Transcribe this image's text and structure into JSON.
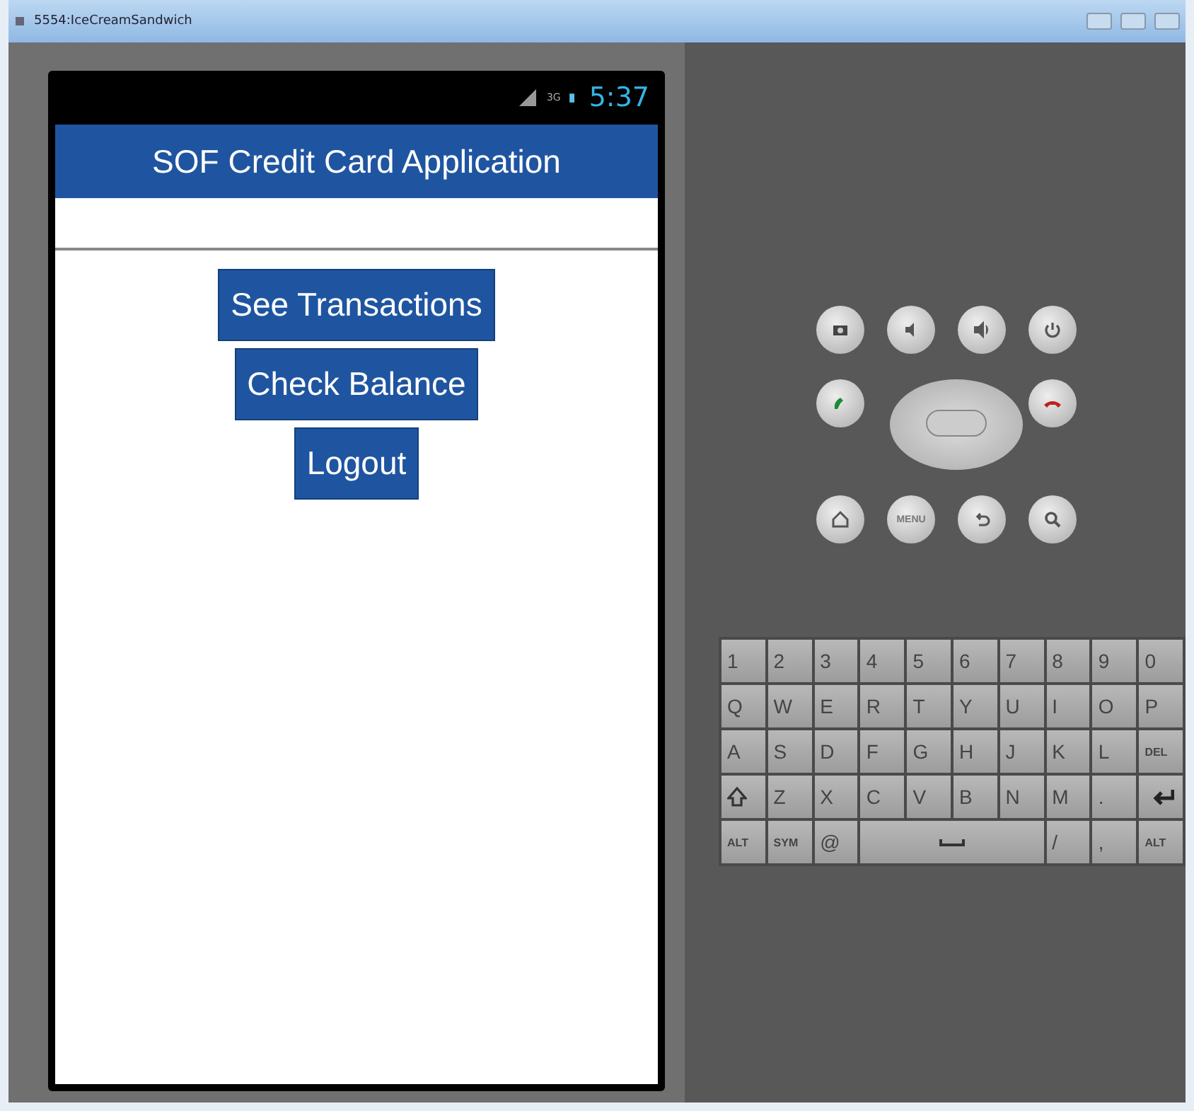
{
  "window": {
    "title": "5554:IceCreamSandwich"
  },
  "status_bar": {
    "network": "3G",
    "time": "5:37"
  },
  "app": {
    "title": "SOF Credit Card Application",
    "buttons": [
      "See Transactions",
      "Check Balance",
      "Logout"
    ]
  },
  "controls": {
    "menu_label": "MENU"
  },
  "keyboard": {
    "rows": [
      [
        {
          "kind": "key",
          "label": "1"
        },
        {
          "kind": "key",
          "label": "2"
        },
        {
          "kind": "key",
          "label": "3"
        },
        {
          "kind": "key",
          "label": "4"
        },
        {
          "kind": "key",
          "label": "5"
        },
        {
          "kind": "key",
          "label": "6"
        },
        {
          "kind": "key",
          "label": "7"
        },
        {
          "kind": "key",
          "label": "8"
        },
        {
          "kind": "key",
          "label": "9"
        },
        {
          "kind": "key",
          "label": "0"
        }
      ],
      [
        {
          "kind": "key",
          "label": "Q"
        },
        {
          "kind": "key",
          "label": "W"
        },
        {
          "kind": "key",
          "label": "E"
        },
        {
          "kind": "key",
          "label": "R"
        },
        {
          "kind": "key",
          "label": "T"
        },
        {
          "kind": "key",
          "label": "Y"
        },
        {
          "kind": "key",
          "label": "U"
        },
        {
          "kind": "key",
          "label": "I"
        },
        {
          "kind": "key",
          "label": "O"
        },
        {
          "kind": "key",
          "label": "P"
        }
      ],
      [
        {
          "kind": "key",
          "label": "A"
        },
        {
          "kind": "key",
          "label": "S"
        },
        {
          "kind": "key",
          "label": "D"
        },
        {
          "kind": "key",
          "label": "F"
        },
        {
          "kind": "key",
          "label": "G"
        },
        {
          "kind": "key",
          "label": "H"
        },
        {
          "kind": "key",
          "label": "J"
        },
        {
          "kind": "key",
          "label": "K"
        },
        {
          "kind": "key",
          "label": "L"
        },
        {
          "kind": "del",
          "label": "DEL"
        }
      ],
      [
        {
          "kind": "shift"
        },
        {
          "kind": "key",
          "label": "Z"
        },
        {
          "kind": "key",
          "label": "X"
        },
        {
          "kind": "key",
          "label": "C"
        },
        {
          "kind": "key",
          "label": "V"
        },
        {
          "kind": "key",
          "label": "B"
        },
        {
          "kind": "key",
          "label": "N"
        },
        {
          "kind": "key",
          "label": "M"
        },
        {
          "kind": "key",
          "label": "."
        },
        {
          "kind": "enter"
        }
      ]
    ],
    "bottom_row": [
      {
        "kind": "small",
        "label": "ALT"
      },
      {
        "kind": "small",
        "label": "SYM"
      },
      {
        "kind": "key",
        "label": "@"
      },
      {
        "kind": "space"
      },
      {
        "kind": "key",
        "label": "/"
      },
      {
        "kind": "key",
        "label": ","
      },
      {
        "kind": "small",
        "label": "ALT"
      }
    ]
  }
}
